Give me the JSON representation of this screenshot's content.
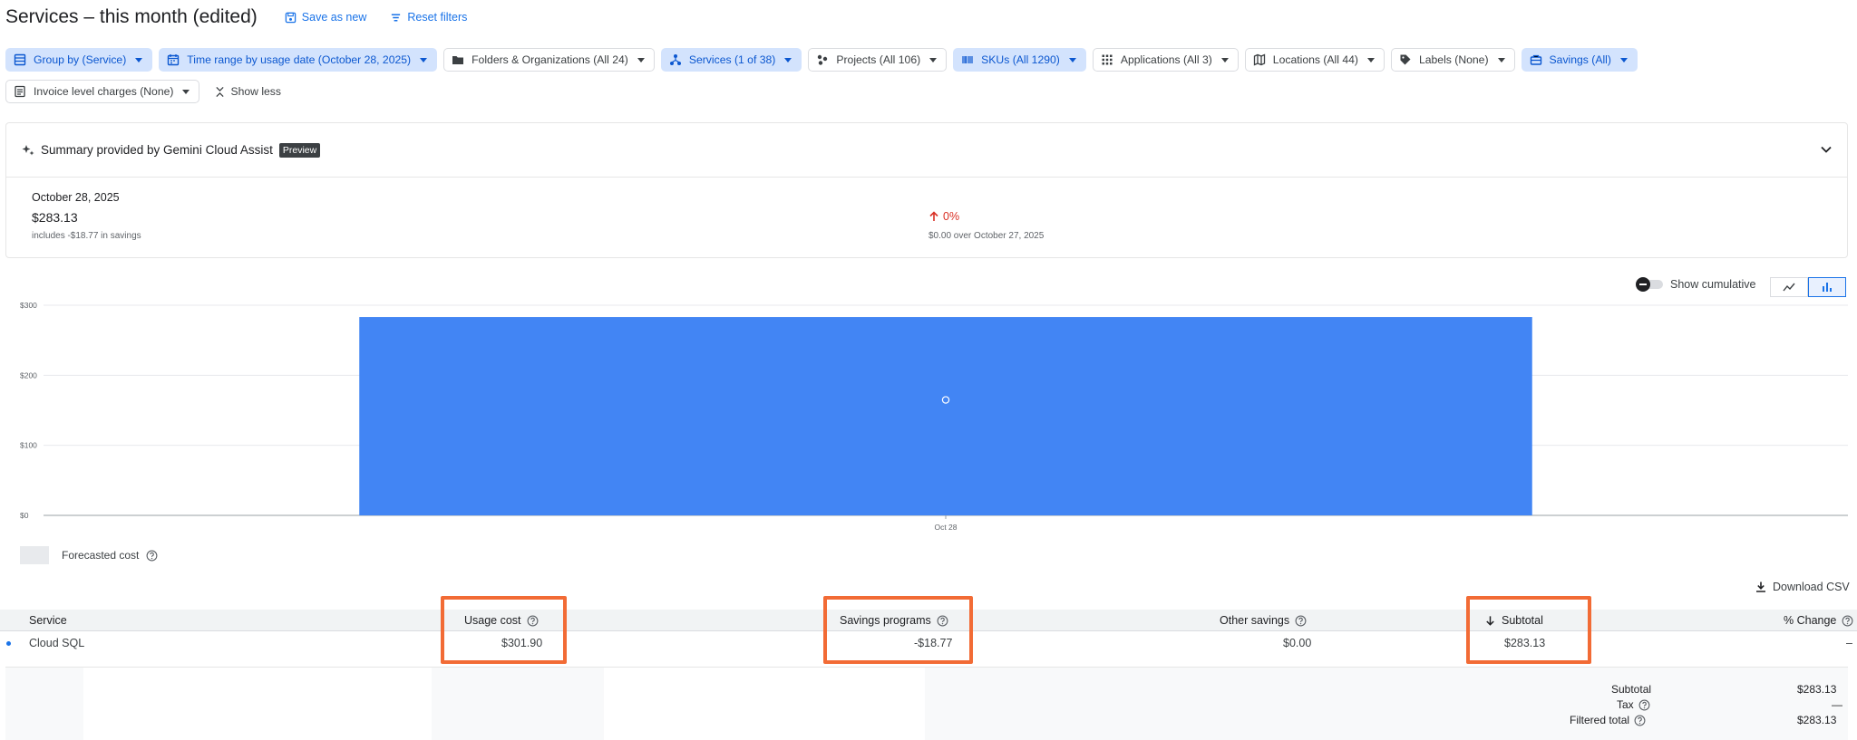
{
  "header": {
    "title": "Services – this month (edited)",
    "save_as_new": "Save as new",
    "reset_filters": "Reset filters"
  },
  "filters": {
    "group_by": "Group by (Service)",
    "time_range": "Time range by usage date (October 28, 2025)",
    "folders": "Folders & Organizations (All 24)",
    "services": "Services (1 of 38)",
    "projects": "Projects (All 106)",
    "skus": "SKUs (All 1290)",
    "applications": "Applications (All 3)",
    "locations": "Locations (All 44)",
    "labels": "Labels (None)",
    "savings": "Savings (All)",
    "invoice": "Invoice level charges (None)",
    "show_less": "Show less"
  },
  "summary": {
    "title": "Summary provided by Gemini Cloud Assist",
    "badge": "Preview",
    "date": "October 28, 2025",
    "amount": "$283.13",
    "note": "includes -$18.77 in savings",
    "change": "0%",
    "change_over": "$0.00 over October 27, 2025"
  },
  "chart_controls": {
    "show_cumulative": "Show cumulative"
  },
  "chart_data": {
    "type": "bar",
    "categories": [
      "Oct 28"
    ],
    "values": [
      283.13
    ],
    "y_ticks": [
      "$0",
      "$100",
      "$200",
      "$300"
    ],
    "ylim": [
      0,
      300
    ],
    "color": "#4285f4",
    "grid": true
  },
  "legend": {
    "forecasted": "Forecasted cost"
  },
  "download": "Download CSV",
  "table": {
    "columns": {
      "service": "Service",
      "usage_cost": "Usage cost",
      "savings_programs": "Savings programs",
      "other_savings": "Other savings",
      "subtotal": "Subtotal",
      "pct_change": "% Change"
    },
    "rows": [
      {
        "service": "Cloud SQL",
        "usage_cost": "$301.90",
        "savings_programs": "-$18.77",
        "other_savings": "$0.00",
        "subtotal": "$283.13",
        "pct_change": "–"
      }
    ]
  },
  "totals": {
    "subtotal_label": "Subtotal",
    "subtotal_value": "$283.13",
    "tax_label": "Tax",
    "tax_value": "—",
    "filtered_label": "Filtered total",
    "filtered_value": "$283.13"
  },
  "colors": {
    "accent": "#1a73e8",
    "chip_active_bg": "#d3e3fd",
    "highlight": "#f26b35",
    "negative": "#d93025"
  }
}
